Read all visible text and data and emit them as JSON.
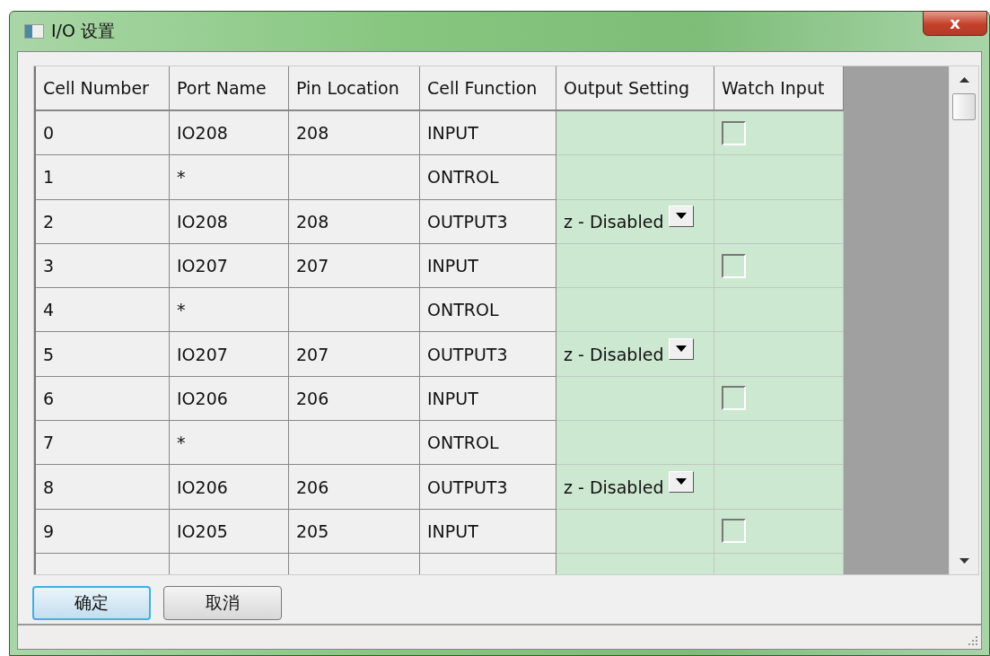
{
  "window": {
    "title": "I/O 设置",
    "close_label": "x"
  },
  "table": {
    "columns": [
      "Cell Number",
      "Port Name",
      "Pin Location",
      "Cell Function",
      "Output Setting",
      "Watch Input"
    ],
    "rows": [
      {
        "kind": "input",
        "cell": "0",
        "port": "IO208",
        "pin": "208",
        "function": "INPUT",
        "watch_checked": false
      },
      {
        "kind": "control",
        "cell": "1",
        "port": "*",
        "pin": "",
        "function": "ONTROL"
      },
      {
        "kind": "output",
        "cell": "2",
        "port": "IO208",
        "pin": "208",
        "function": "OUTPUT3",
        "output": "z - Disabled"
      },
      {
        "kind": "input",
        "cell": "3",
        "port": "IO207",
        "pin": "207",
        "function": "INPUT",
        "watch_checked": false
      },
      {
        "kind": "control",
        "cell": "4",
        "port": "*",
        "pin": "",
        "function": "ONTROL"
      },
      {
        "kind": "output",
        "cell": "5",
        "port": "IO207",
        "pin": "207",
        "function": "OUTPUT3",
        "output": "z - Disabled"
      },
      {
        "kind": "input",
        "cell": "6",
        "port": "IO206",
        "pin": "206",
        "function": "INPUT",
        "watch_checked": false
      },
      {
        "kind": "control",
        "cell": "7",
        "port": "*",
        "pin": "",
        "function": "ONTROL"
      },
      {
        "kind": "output",
        "cell": "8",
        "port": "IO206",
        "pin": "206",
        "function": "OUTPUT3",
        "output": "z - Disabled"
      },
      {
        "kind": "input",
        "cell": "9",
        "port": "IO205",
        "pin": "205",
        "function": "INPUT",
        "watch_checked": false
      },
      {
        "kind": "control"
      }
    ]
  },
  "buttons": [
    {
      "label": "确定",
      "default": true
    },
    {
      "label": "取消",
      "default": false
    }
  ]
}
